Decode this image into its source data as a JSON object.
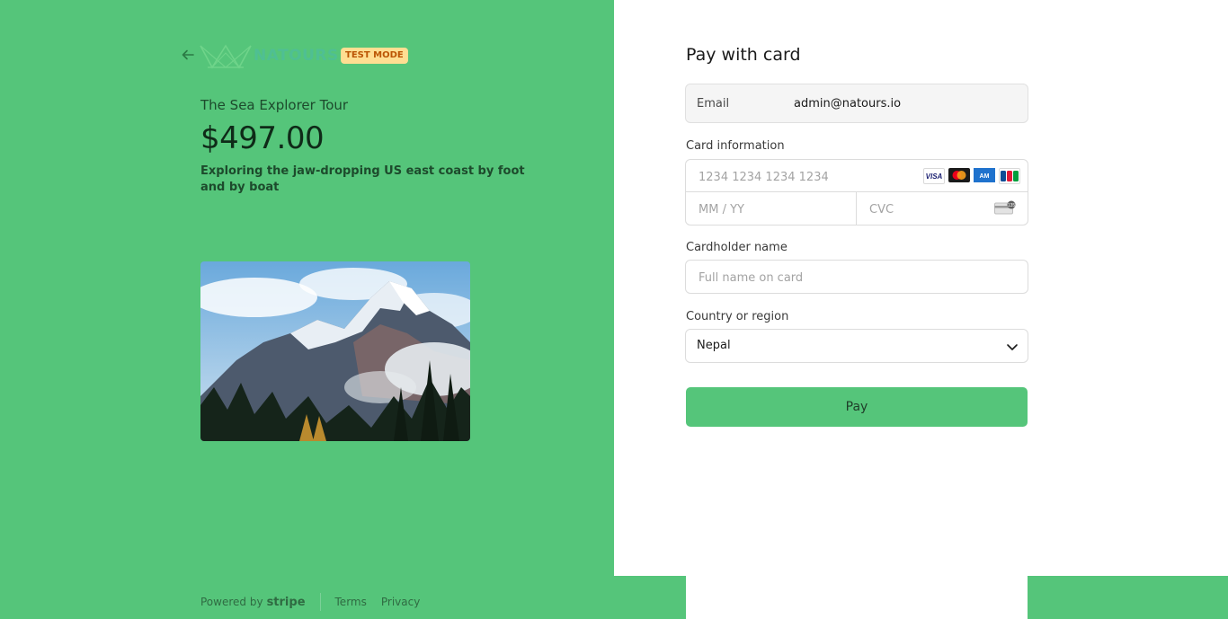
{
  "header": {
    "logo_text": "NATOURS",
    "test_badge": "TEST MODE",
    "back_icon": "arrow-left-icon"
  },
  "product": {
    "name": "The Sea Explorer Tour",
    "price": "$497.00",
    "description": "Exploring the jaw-dropping US east coast by foot and by boat",
    "image_alt": "Snowy mountains with pine forest"
  },
  "footer": {
    "powered_by": "Powered by",
    "stripe": "stripe",
    "terms": "Terms",
    "privacy": "Privacy"
  },
  "form": {
    "title": "Pay with card",
    "email_label": "Email",
    "email_value": "admin@natours.io",
    "card_label": "Card information",
    "card_number_placeholder": "1234 1234 1234 1234",
    "expiry_placeholder": "MM / YY",
    "cvc_placeholder": "CVC",
    "card_brands": [
      "VISA",
      "mastercard",
      "amex",
      "jcb"
    ],
    "cardholder_label": "Cardholder name",
    "cardholder_placeholder": "Full name on card",
    "country_label": "Country or region",
    "country_value": "Nepal",
    "pay_label": "Pay"
  },
  "colors": {
    "brand_green": "#55c57a",
    "badge_bg": "#ffde92",
    "badge_text": "#bb5504",
    "white": "#ffffff"
  }
}
